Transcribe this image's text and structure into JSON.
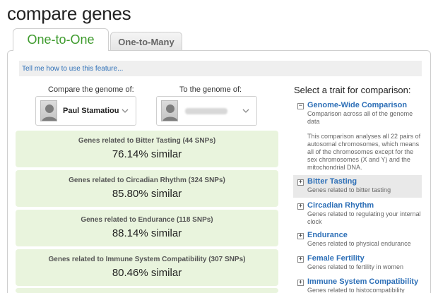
{
  "page": {
    "title": "compare genes"
  },
  "tabs": [
    {
      "label": "One-to-One",
      "active": true
    },
    {
      "label": "One-to-Many",
      "active": false
    }
  ],
  "help": {
    "link_text": "Tell me how to use this feature..."
  },
  "compare": {
    "from_label": "Compare the genome of:",
    "to_label": "To the genome of:",
    "from_name": "Paul Stamatiou",
    "to_name": ""
  },
  "results": [
    {
      "title": "Genes related to Bitter Tasting (44 SNPs)",
      "value": "76.14% similar"
    },
    {
      "title": "Genes related to Circadian Rhythm (324 SNPs)",
      "value": "85.80% similar"
    },
    {
      "title": "Genes related to Endurance (118 SNPs)",
      "value": "88.14% similar"
    },
    {
      "title": "Genes related to Immune System Compatibility (307 SNPs)",
      "value": "80.46% similar"
    }
  ],
  "traits_panel": {
    "heading": "Select a trait for comparison:",
    "items": [
      {
        "name": "Genome-Wide Comparison",
        "desc": "Comparison across all of the genome data",
        "extra": "This comparison analyses all 22 pairs of autosomal chromosomes, which means all of the chromosomes except for the sex chromosomes (X and Y) and the mitochondrial DNA.",
        "toggle": "−"
      },
      {
        "name": "Bitter Tasting",
        "desc": "Genes related to bitter tasting",
        "toggle": "+"
      },
      {
        "name": "Circadian Rhythm",
        "desc": "Genes related to regulating your internal clock",
        "toggle": "+"
      },
      {
        "name": "Endurance",
        "desc": "Genes related to physical endurance",
        "toggle": "+"
      },
      {
        "name": "Female Fertility",
        "desc": "Genes related to fertility in women",
        "toggle": "+"
      },
      {
        "name": "Immune System Compatibility",
        "desc": "Genes related to histocompatibility",
        "toggle": "+"
      }
    ]
  },
  "colors": {
    "accent_green": "#3f9b2e",
    "link_blue": "#2d6fb7",
    "result_bg": "#e9f4dd"
  }
}
